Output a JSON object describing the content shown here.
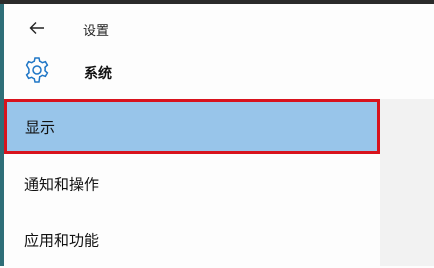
{
  "window": {
    "title": "设置"
  },
  "header": {
    "back_icon": "back-arrow-icon"
  },
  "section": {
    "icon": "gear-icon",
    "title": "系统"
  },
  "nav": {
    "items": [
      {
        "label": "显示",
        "selected": true
      },
      {
        "label": "通知和操作",
        "selected": false
      },
      {
        "label": "应用和功能",
        "selected": false
      }
    ]
  },
  "colors": {
    "selected_bg": "#98c5ea",
    "highlight_border": "#d8131d",
    "accent_edge": "#2e6e78",
    "icon_blue": "#1f76c6"
  }
}
